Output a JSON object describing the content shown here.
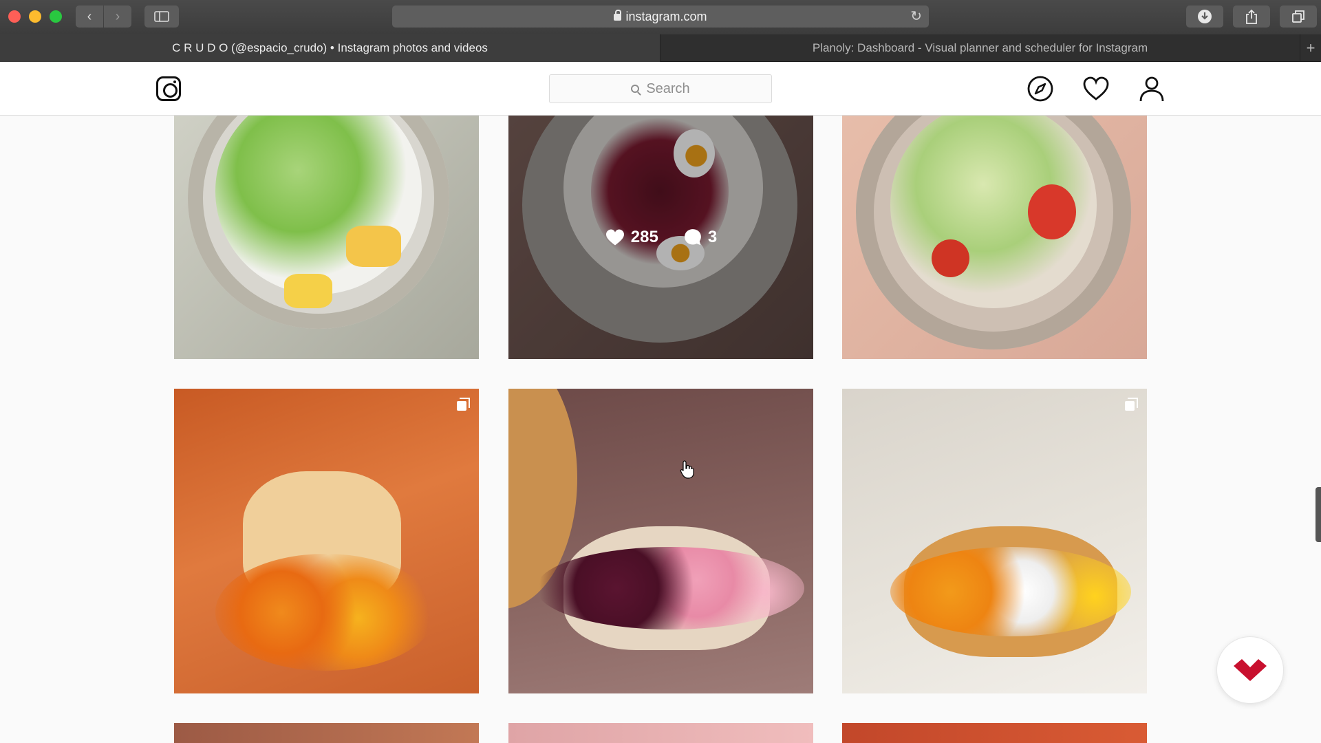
{
  "browser": {
    "url": "instagram.com",
    "tabs": [
      {
        "label": "C R U D O (@espacio_crudo) • Instagram photos and videos",
        "active": true
      },
      {
        "label": "Planoly: Dashboard - Visual planner and scheduler for Instagram",
        "active": false
      }
    ]
  },
  "instagram": {
    "search_placeholder": "Search",
    "hover_post": {
      "likes": "285",
      "comments": "3"
    }
  },
  "colors": {
    "accent_red": "#c8102e",
    "traffic_red": "#fe5f57",
    "traffic_yellow": "#febb2e",
    "traffic_green": "#29c840"
  },
  "icons": [
    "instagram-logo-icon",
    "search-icon",
    "explore-compass-icon",
    "heart-icon",
    "profile-icon",
    "multi-photo-icon",
    "reload-icon",
    "download-icon",
    "share-icon",
    "tabs-icon"
  ]
}
